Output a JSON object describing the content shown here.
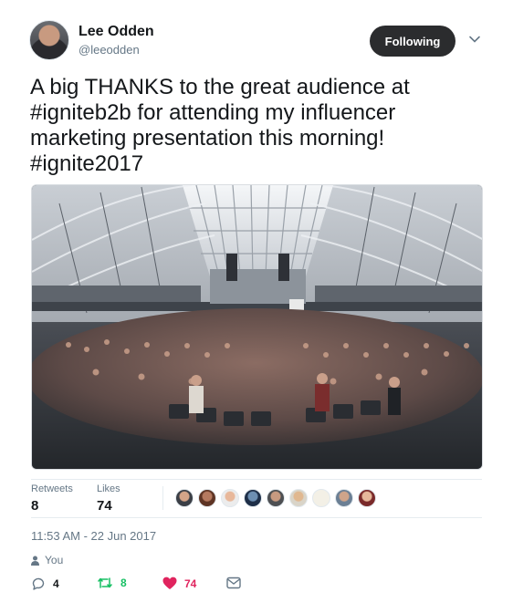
{
  "author": {
    "name": "Lee Odden",
    "handle": "@leeodden"
  },
  "follow_button": {
    "label": "Following"
  },
  "tweet": {
    "lines": [
      "A big THANKS to the great audience at",
      "#igniteb2b for attending my influencer",
      "marketing presentation this morning!",
      "#ignite2017"
    ]
  },
  "stats": {
    "retweets_label": "Retweets",
    "retweets_count": "8",
    "likes_label": "Likes",
    "likes_count": "74"
  },
  "timestamp": "11:53 AM - 22 Jun 2017",
  "retweeted_by": "You",
  "actions": {
    "reply_count": "4",
    "retweet_count": "8",
    "like_count": "74"
  },
  "colors": {
    "retweet_green": "#17bf63",
    "like_red": "#e0245e",
    "muted": "#657786",
    "button_dark": "#2b2c2e"
  },
  "icons": [
    "chevron-down-icon",
    "person-icon",
    "reply-icon",
    "retweet-icon",
    "heart-icon",
    "message-icon"
  ]
}
